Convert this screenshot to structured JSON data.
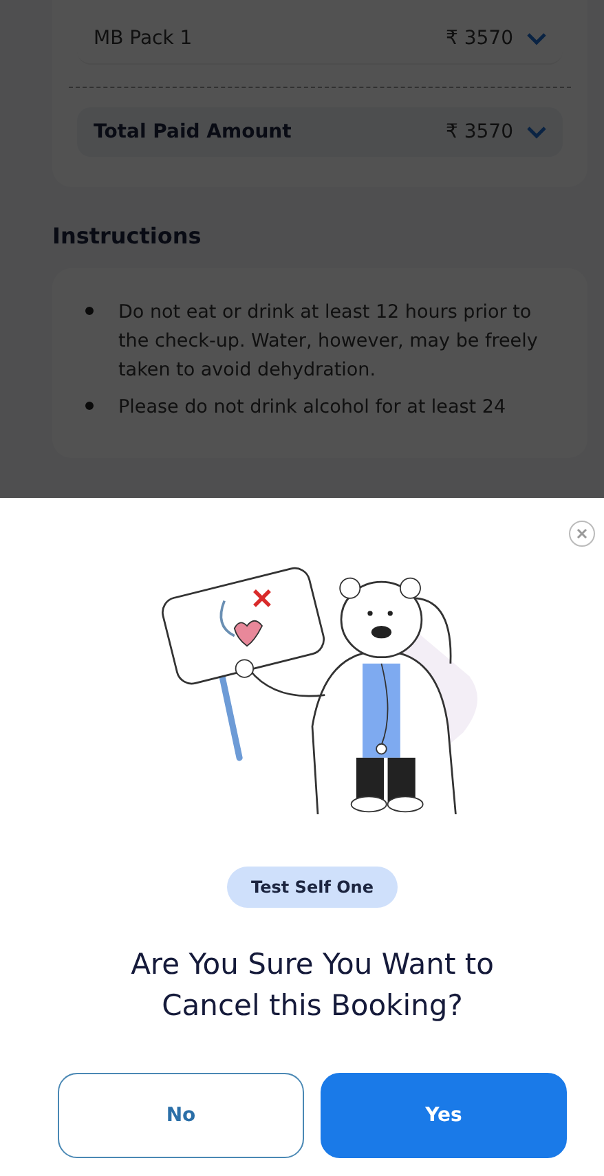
{
  "summary": {
    "items": [
      {
        "name": "MB Pack 1",
        "amount": "₹ 3570",
        "kind": "item"
      },
      {
        "name": "Total Paid Amount",
        "amount": "₹ 3570",
        "kind": "total"
      }
    ]
  },
  "instructions": {
    "title": "Instructions",
    "items": [
      "Do not eat or drink at least 12 hours prior to the check-up. Water, however, may be freely taken to avoid dehydration.",
      "Please do not drink alcohol for at least 24"
    ]
  },
  "dialog": {
    "patient": "Test Self One",
    "question": "Are You Sure You Want to Cancel this Booking?",
    "buttons": [
      {
        "label": "No",
        "kind": "secondary"
      },
      {
        "label": "Yes",
        "kind": "primary"
      }
    ]
  }
}
